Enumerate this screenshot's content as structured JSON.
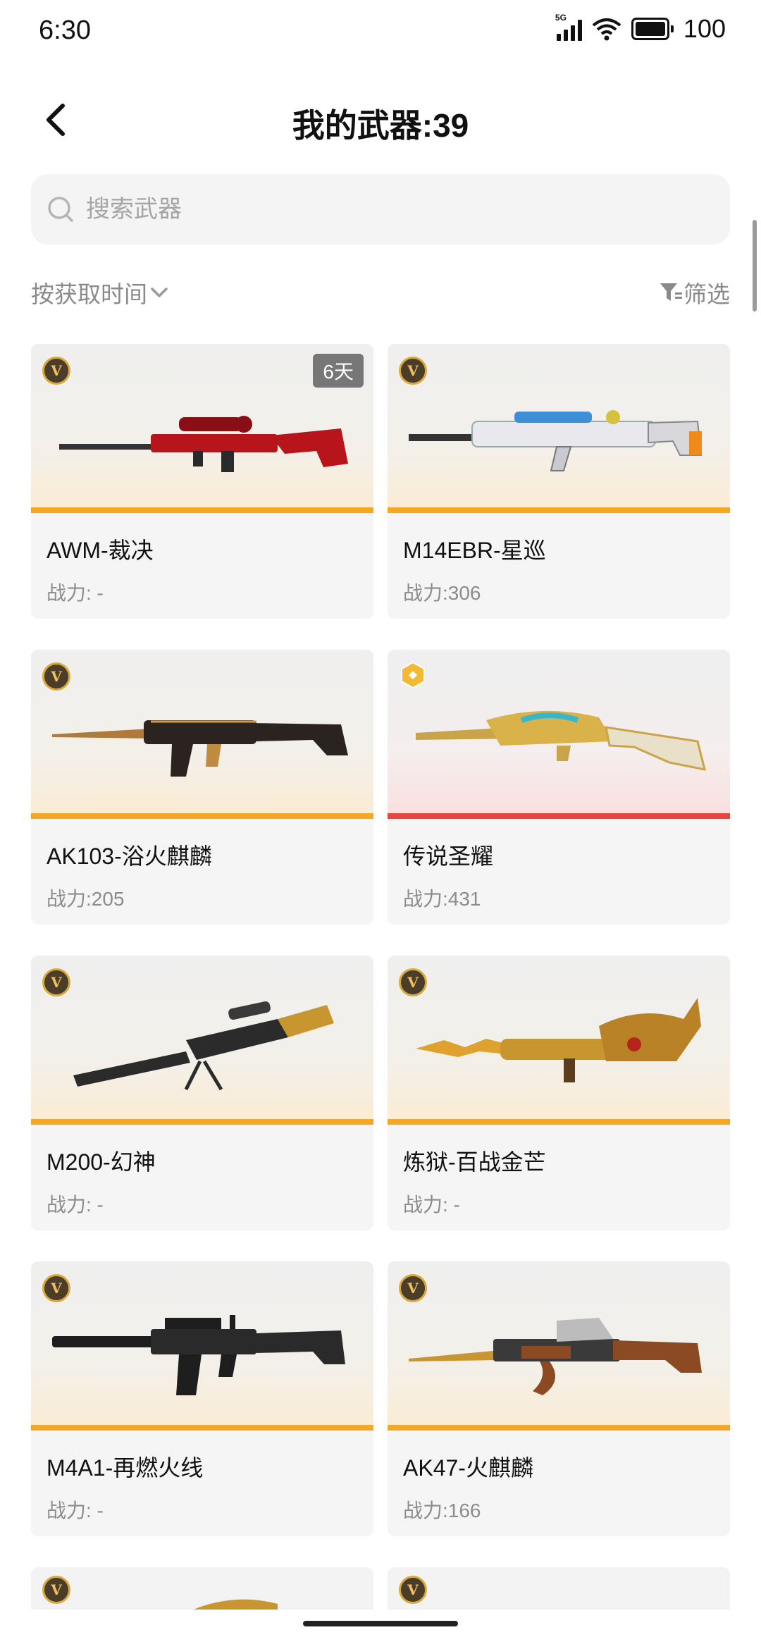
{
  "status_bar": {
    "time": "6:30",
    "network": "5G",
    "battery": "100"
  },
  "header": {
    "title": "我的武器:39"
  },
  "search": {
    "placeholder": "搜索武器"
  },
  "sort": {
    "label": "按获取时间",
    "filter_label": "筛选"
  },
  "colors": {
    "gold_accent": "#f5a623",
    "legend_accent": "#e8453c",
    "muted_text": "#8c8c8c"
  },
  "weapons": [
    {
      "name": "AWM-裁决",
      "power": "战力: -",
      "badge": "v-icon",
      "tag": "6天",
      "art_color": "#b8141b"
    },
    {
      "name": "M14EBR-星巡",
      "power": "战力:306",
      "badge": "v-icon",
      "art_color": "#3d8fd8"
    },
    {
      "name": "AK103-浴火麒麟",
      "power": "战力:205",
      "badge": "v-icon",
      "art_color": "#2a2320"
    },
    {
      "name": "传说圣耀",
      "power": "战力:431",
      "badge": "legend-icon",
      "art_color": "#d9b24a"
    },
    {
      "name": "M200-幻神",
      "power": "战力: -",
      "badge": "v-icon",
      "art_color": "#2b2b2b"
    },
    {
      "name": "炼狱-百战金芒",
      "power": "战力: -",
      "badge": "v-icon",
      "art_color": "#c8962e"
    },
    {
      "name": "M4A1-再燃火线",
      "power": "战力: -",
      "badge": "v-icon",
      "art_color": "#1e1e1e"
    },
    {
      "name": "AK47-火麒麟",
      "power": "战力:166",
      "badge": "v-icon",
      "art_color": "#8b4a22"
    }
  ]
}
